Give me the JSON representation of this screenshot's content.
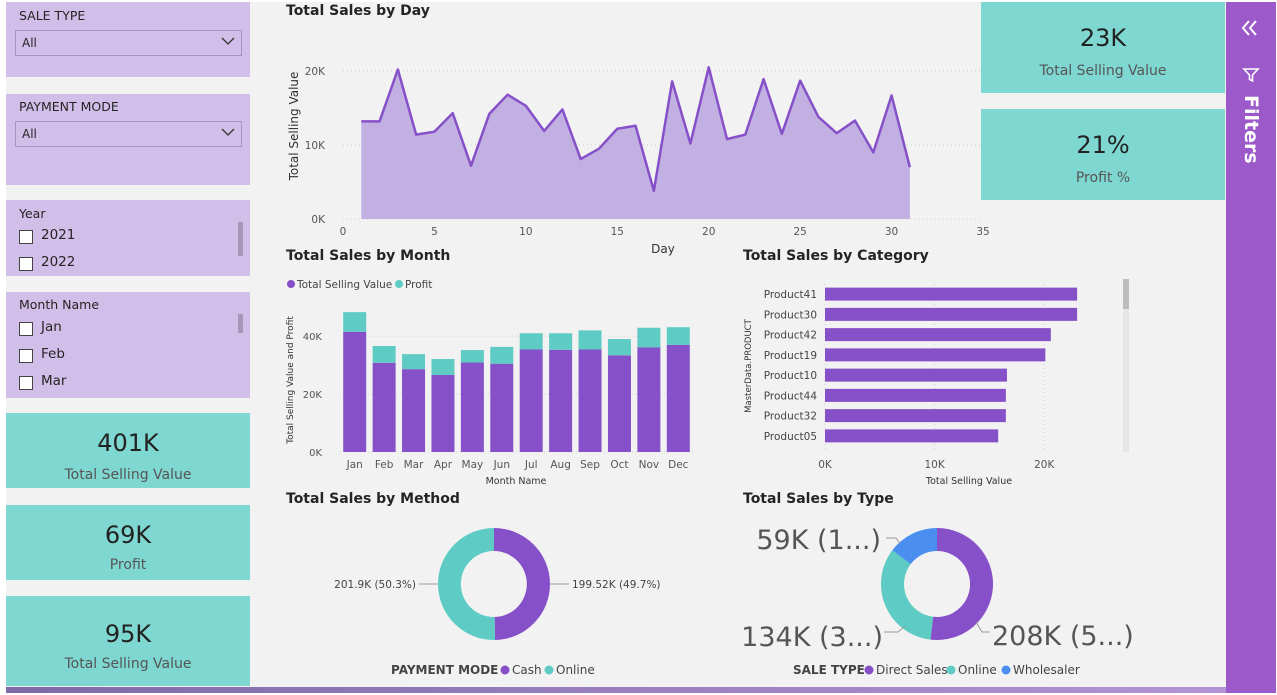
{
  "slicers": {
    "sale_type": {
      "title": "SALE TYPE",
      "value": "All"
    },
    "payment_mode": {
      "title": "PAYMENT MODE",
      "value": "All"
    },
    "year": {
      "title": "Year",
      "items": [
        "2021",
        "2022"
      ]
    },
    "month_name": {
      "title": "Month Name",
      "items": [
        "Jan",
        "Feb",
        "Mar"
      ]
    }
  },
  "left_cards": [
    {
      "value": "401K",
      "label": "Total Selling Value"
    },
    {
      "value": "69K",
      "label": "Profit"
    },
    {
      "value": "95K",
      "label": "Total Selling Value"
    }
  ],
  "right_cards": [
    {
      "value": "23K",
      "label": "Total Selling Value"
    },
    {
      "value": "21%",
      "label": "Profit %"
    }
  ],
  "filters_pane": {
    "label": "Filters",
    "collapse_icon": "double-chevron-left-icon",
    "filter_icon": "funnel-icon"
  },
  "colors": {
    "purple": "#8650c8",
    "teal": "#5ecbc4",
    "blue": "#4a8eef",
    "area_fill": "#c3b0e2"
  },
  "chart_data": [
    {
      "type": "area",
      "title": "Total Sales by Day",
      "xlabel": "Day",
      "ylabel": "Total Selling Value",
      "x_ticks": [
        "0",
        "5",
        "10",
        "15",
        "20",
        "25",
        "30",
        "35"
      ],
      "y_ticks": [
        "0K",
        "10K",
        "20K"
      ],
      "xlim": [
        0,
        35
      ],
      "ylim": [
        0,
        20000
      ],
      "x": [
        1,
        2,
        3,
        4,
        5,
        6,
        7,
        8,
        9,
        10,
        11,
        12,
        13,
        14,
        15,
        16,
        17,
        18,
        19,
        20,
        21,
        22,
        23,
        24,
        25,
        26,
        27,
        28,
        29,
        30,
        31
      ],
      "values": [
        13200,
        13200,
        20200,
        11400,
        11800,
        14300,
        7200,
        14200,
        16800,
        15300,
        11900,
        14800,
        8100,
        9500,
        12200,
        12600,
        3800,
        18600,
        10200,
        20500,
        10800,
        11400,
        18900,
        11500,
        18700,
        13800,
        11600,
        13300,
        9000,
        16700,
        7000
      ],
      "grid": true
    },
    {
      "type": "bar",
      "stacked": true,
      "title": "Total Sales by Month",
      "xlabel": "Month Name",
      "ylabel": "Total Selling Value and Profit",
      "legend_position": "top-left",
      "categories": [
        "Jan",
        "Feb",
        "Mar",
        "Apr",
        "May",
        "Jun",
        "Jul",
        "Aug",
        "Sep",
        "Oct",
        "Nov",
        "Dec"
      ],
      "y_ticks": [
        "0K",
        "20K",
        "40K"
      ],
      "ylim": [
        0,
        48000
      ],
      "series": [
        {
          "name": "Total Selling Value",
          "values": [
            41500,
            30800,
            28600,
            26600,
            30900,
            30500,
            35400,
            35300,
            35400,
            33400,
            36100,
            37000
          ]
        },
        {
          "name": "Profit",
          "values": [
            6800,
            5800,
            5200,
            5500,
            4300,
            5800,
            5600,
            5700,
            6600,
            5600,
            6800,
            6100
          ]
        }
      ],
      "grid": true
    },
    {
      "type": "bar",
      "orientation": "horizontal",
      "title": "Total Sales by Category",
      "xlabel": "Total Selling Value",
      "ylabel": "MasterData.PRODUCT",
      "categories": [
        "Product41",
        "Product30",
        "Product42",
        "Product19",
        "Product10",
        "Product44",
        "Product32",
        "Product05"
      ],
      "values": [
        23000,
        23000,
        20600,
        20100,
        16600,
        16500,
        16500,
        15800
      ],
      "x_ticks": [
        "0K",
        "10K",
        "20K"
      ],
      "xlim": [
        0,
        26000
      ],
      "grid": true
    },
    {
      "type": "pie",
      "donut": true,
      "title": "Total Sales by Method",
      "legend_title": "PAYMENT MODE",
      "legend_position": "bottom",
      "slices": [
        {
          "name": "Cash",
          "value": 199520,
          "label": "199.52K (49.7%)"
        },
        {
          "name": "Online",
          "value": 201900,
          "label": "201.9K (50.3%)"
        }
      ]
    },
    {
      "type": "pie",
      "donut": true,
      "title": "Total Sales by Type",
      "legend_title": "SALE TYPE",
      "legend_position": "bottom",
      "slices": [
        {
          "name": "Direct Sales",
          "value": 208000,
          "label": "208K (5...)"
        },
        {
          "name": "Online",
          "value": 134000,
          "label": "134K (3...)"
        },
        {
          "name": "Wholesaler",
          "value": 59000,
          "label": "59K (1...)"
        }
      ]
    }
  ]
}
